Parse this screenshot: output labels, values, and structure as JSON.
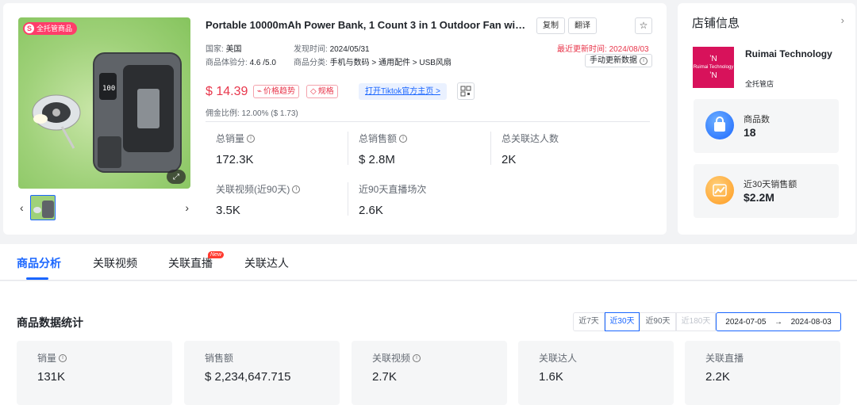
{
  "product": {
    "managed_badge": "全托管商品",
    "title": "Portable 10000mAh Power Bank, 1 Count 3 in 1 Outdoor Fan with...",
    "copy_label": "复制",
    "translate_label": "翻译",
    "country_label": "国家:",
    "country_value": "美国",
    "discovered_label": "发现时间:",
    "discovered_value": "2024/05/31",
    "updated_label": "最近更新时间:",
    "updated_value": "2024/08/03",
    "rating_label": "商品体验分:",
    "rating_value": "4.6 /5.0",
    "category_label": "商品分类:",
    "category_value": "手机与数码 > 通用配件 > USB风扇",
    "refresh_label": "手动更新数据",
    "price": "$ 14.39",
    "price_trend_label": "价格趋势",
    "spec_label": "规格",
    "tiktok_label": "打开Tiktok官方主页 >",
    "commission": "佣金比例: 12.00% ($ 1.73)",
    "stats": [
      {
        "label": "总销量",
        "value": "172.3K",
        "info": true
      },
      {
        "label": "总销售额",
        "value": "$ 2.8M",
        "info": true
      },
      {
        "label": "总关联达人数",
        "value": "2K",
        "info": false
      },
      {
        "label": "关联视频(近90天)",
        "value": "3.5K",
        "info": true
      },
      {
        "label": "近90天直播场次",
        "value": "2.6K",
        "info": false
      }
    ]
  },
  "store": {
    "title": "店铺信息",
    "logo_text": "Ruimai Technology",
    "name": "Ruimai Technology",
    "tag": "全托管店",
    "products_label": "商品数",
    "products_value": "18",
    "sales_label": "近30天销售额",
    "sales_value": "$2.2M"
  },
  "tabs": [
    {
      "label": "商品分析",
      "active": true
    },
    {
      "label": "关联视频",
      "active": false
    },
    {
      "label": "关联直播",
      "active": false,
      "badge": "New"
    },
    {
      "label": "关联达人",
      "active": false
    }
  ],
  "stats_section": {
    "title": "商品数据统计",
    "ranges": [
      {
        "label": "近7天",
        "state": "normal"
      },
      {
        "label": "近30天",
        "state": "active"
      },
      {
        "label": "近90天",
        "state": "normal"
      },
      {
        "label": "近180天",
        "state": "disabled"
      }
    ],
    "date_start": "2024-07-05",
    "date_arrow": "→",
    "date_end": "2024-08-03",
    "metrics": [
      {
        "label": "销量",
        "value": "131K",
        "info": true
      },
      {
        "label": "销售额",
        "value": "$ 2,234,647.715",
        "info": false
      },
      {
        "label": "关联视频",
        "value": "2.7K",
        "info": true
      },
      {
        "label": "关联达人",
        "value": "1.6K",
        "info": false
      },
      {
        "label": "关联直播",
        "value": "2.2K",
        "info": false
      }
    ]
  },
  "colors": {
    "accent": "#1a66ff",
    "price": "#e8364b",
    "managed_badge": "#ff3d6a",
    "store_logo": "#d8125b"
  }
}
